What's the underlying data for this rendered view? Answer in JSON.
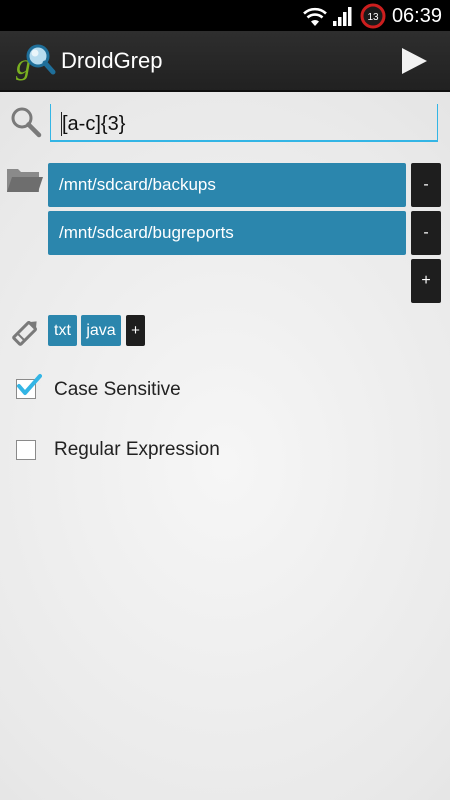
{
  "status_bar": {
    "time": "06:39",
    "battery_level": "13"
  },
  "action_bar": {
    "title": "DroidGrep",
    "run_icon": "play-icon"
  },
  "search": {
    "value": "[a-c]{3}"
  },
  "paths": {
    "items": [
      {
        "label": "/mnt/sdcard/backups",
        "remove_label": "-"
      },
      {
        "label": "/mnt/sdcard/bugreports",
        "remove_label": "-"
      }
    ],
    "add_label": "+"
  },
  "extensions": {
    "items": [
      "txt",
      "java"
    ],
    "add_label": "+"
  },
  "options": {
    "case_sensitive": {
      "label": "Case Sensitive",
      "checked": true
    },
    "regular_expression": {
      "label": "Regular Expression",
      "checked": false
    }
  },
  "colors": {
    "accent": "#33b5e5",
    "button_blue": "#2b86ad",
    "dark_button": "#1e1e1e",
    "action_bar": "#262626"
  }
}
